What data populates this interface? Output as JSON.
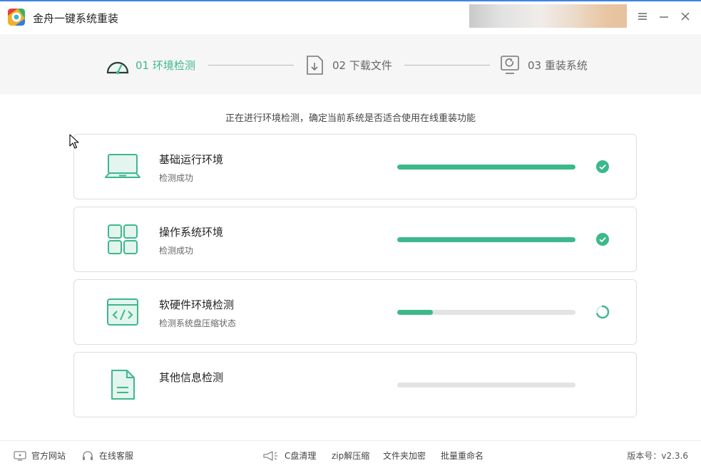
{
  "app": {
    "title": "金舟一键系统重装",
    "icons": [
      "app-logo",
      "menu-icon",
      "minimize-icon",
      "close-icon"
    ]
  },
  "steps": [
    {
      "label": "01 环境检测",
      "icon": "speedometer-icon",
      "active": true
    },
    {
      "label": "02 下载文件",
      "icon": "download-file-icon",
      "active": false
    },
    {
      "label": "03 重装系统",
      "icon": "monitor-refresh-icon",
      "active": false
    }
  ],
  "subtitle": "正在进行环境检测，确定当前系统是否适合使用在线重装功能",
  "checks": [
    {
      "title": "基础运行环境",
      "status": "检测成功",
      "icon": "laptop-icon",
      "progress": 1.0,
      "state": "done"
    },
    {
      "title": "操作系统环境",
      "status": "检测成功",
      "icon": "windows-grid-icon",
      "progress": 1.0,
      "state": "done"
    },
    {
      "title": "软硬件环境检测",
      "status": "检测系统盘压缩状态",
      "icon": "code-window-icon",
      "progress": 0.2,
      "state": "loading"
    },
    {
      "title": "其他信息检测",
      "status": "",
      "icon": "document-icon",
      "progress": 0.0,
      "state": "pending"
    }
  ],
  "footer": {
    "left": [
      {
        "label": "官方网站",
        "icon": "website-icon"
      },
      {
        "label": "在线客服",
        "icon": "headset-icon"
      }
    ],
    "tools": [
      {
        "label": "C盘清理",
        "icon": "megaphone-icon"
      },
      {
        "label": "zip解压缩"
      },
      {
        "label": "文件夹加密"
      },
      {
        "label": "批量重命名"
      }
    ],
    "version": "版本号：v2.3.6"
  },
  "colors": {
    "accent": "#3db88b",
    "track": "#e3e3e3",
    "text": "#333333",
    "header_bg": "#f6f6f6"
  }
}
